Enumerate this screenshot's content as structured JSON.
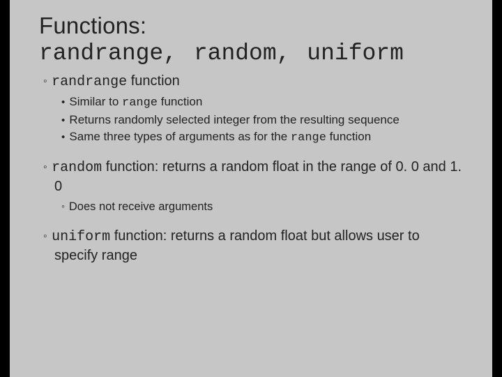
{
  "title": {
    "line1": "Functions:",
    "line2_code1": "randrange",
    "line2_sep1": ", ",
    "line2_code2": "random",
    "line2_sep2": ", ",
    "line2_code3": "uniform"
  },
  "bul": {
    "randrange": {
      "code": "randrange",
      "text": " function",
      "sub": [
        {
          "pre": "Similar to ",
          "code": "range",
          "post": " function"
        },
        {
          "pre": "Returns randomly selected integer from the resulting sequence",
          "code": "",
          "post": ""
        },
        {
          "pre": "Same three types of arguments as for the ",
          "code": "range",
          "post": " function"
        }
      ]
    },
    "random": {
      "code": "random",
      "text": " function: returns a random float in the range of 0. 0 and 1. 0",
      "sub3": "Does not receive arguments"
    },
    "uniform": {
      "code": "uniform",
      "text": " function: returns a random float but allows user to specify range"
    }
  }
}
